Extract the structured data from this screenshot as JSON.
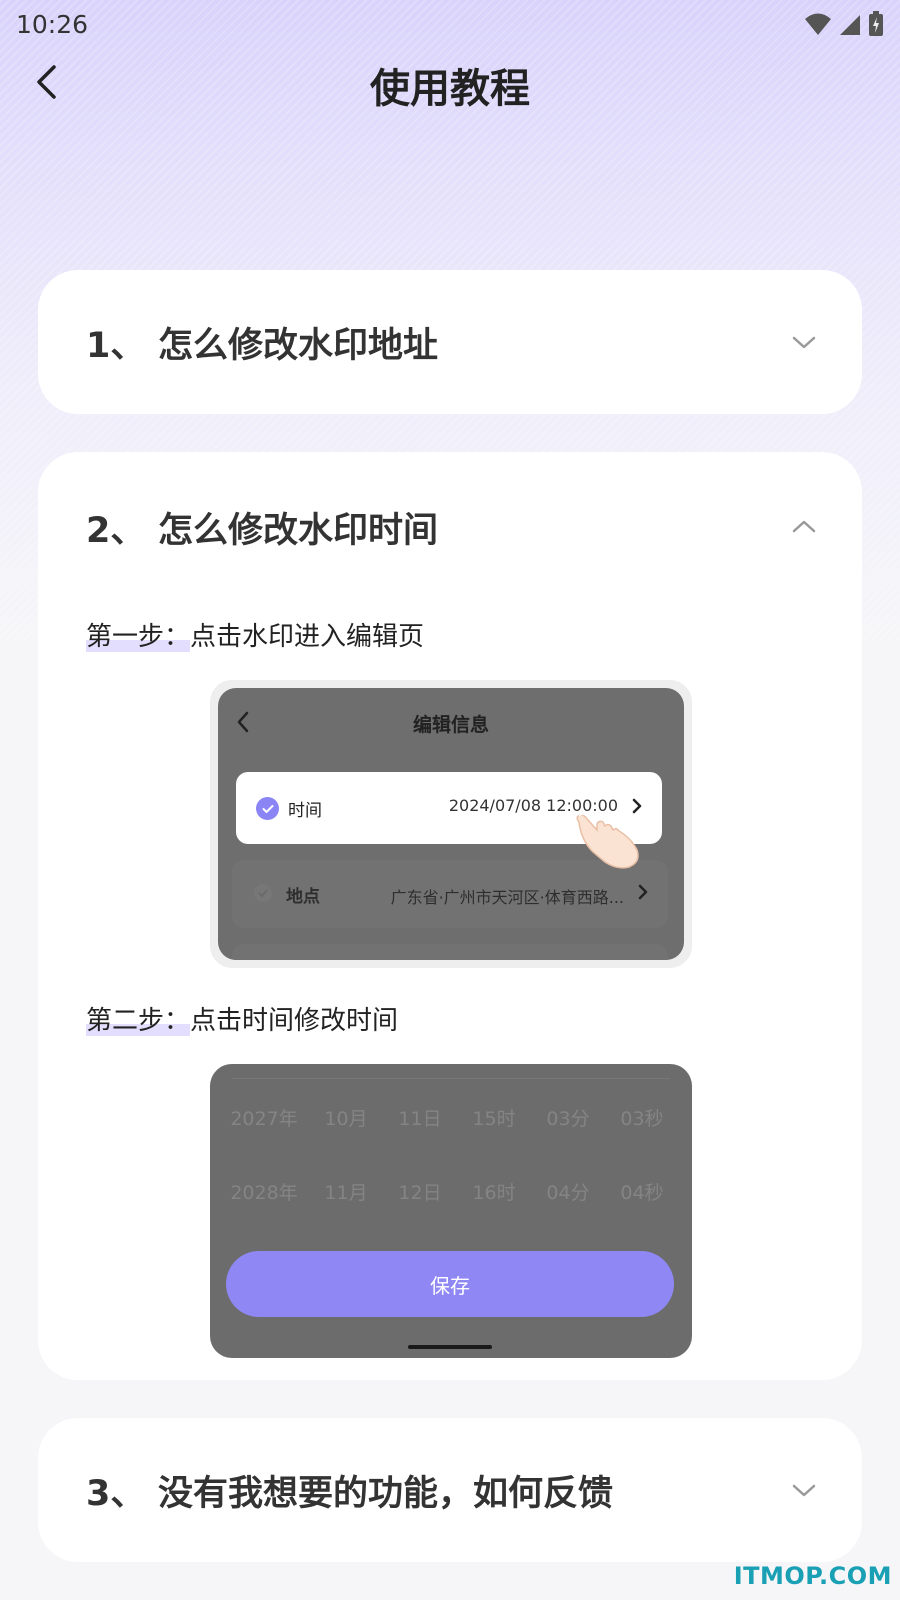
{
  "status_bar": {
    "time": "10:26"
  },
  "header": {
    "title": "使用教程"
  },
  "faq": [
    {
      "num": "1、",
      "title": "怎么修改水印地址",
      "expanded": false
    },
    {
      "num": "2、",
      "title": "怎么修改水印时间",
      "expanded": true
    },
    {
      "num": "3、",
      "title": "没有我想要的功能，如何反馈",
      "expanded": false
    }
  ],
  "steps": {
    "step1": {
      "prefix": "第一步：",
      "text": "点击水印进入编辑页"
    },
    "step2": {
      "prefix": "第二步：",
      "text": "点击时间修改时间"
    }
  },
  "mock_edit": {
    "title": "编辑信息",
    "row_time": {
      "label": "时间",
      "value": "2024/07/08 12:00:00"
    },
    "row_location": {
      "label": "地点",
      "value": "广东省·广州市天河区·体育西路..."
    }
  },
  "mock_picker": {
    "row1": [
      "2027年",
      "10月",
      "11日",
      "15时",
      "03分",
      "03秒"
    ],
    "row2": [
      "2028年",
      "11月",
      "12日",
      "16时",
      "04分",
      "04秒"
    ],
    "save_label": "保存"
  },
  "watermark": "ITMOP.COM",
  "colors": {
    "accent": "#8f88f4",
    "bg_top": "#d9d3fb",
    "watermark": "#1aa0b4"
  }
}
